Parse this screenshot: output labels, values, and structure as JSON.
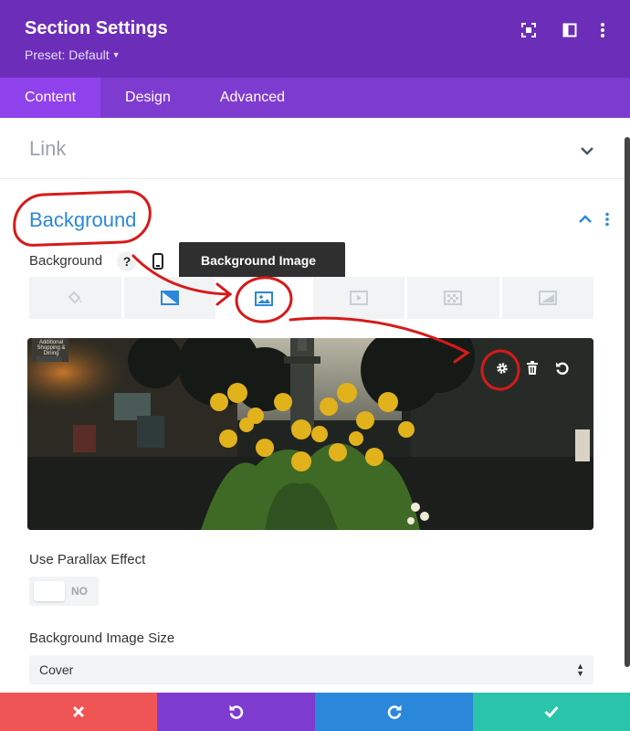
{
  "header": {
    "title": "Section Settings",
    "preset": "Preset: Default",
    "icons": [
      "expand-icon",
      "sidebar-icon",
      "more-vertical-icon"
    ],
    "background_color": "#6c2eb9"
  },
  "tabs": [
    {
      "label": "Content",
      "active": true
    },
    {
      "label": "Design",
      "active": false
    },
    {
      "label": "Advanced",
      "active": false
    }
  ],
  "sections": {
    "link": {
      "title": "Link",
      "expanded": false
    },
    "background": {
      "title": "Background",
      "expanded": true,
      "field_label": "Background",
      "help_symbol": "?",
      "tooltip": "Background Image",
      "type_tabs": [
        {
          "icon": "paint-bucket-icon",
          "active": false
        },
        {
          "icon": "gradient-icon",
          "active": false
        },
        {
          "icon": "image-icon",
          "active": true
        },
        {
          "icon": "video-icon",
          "active": false
        },
        {
          "icon": "pattern-icon",
          "active": false
        },
        {
          "icon": "mask-icon",
          "active": false
        }
      ],
      "preview": {
        "sign_text": "Additional Shopping & Dining",
        "actions": [
          "settings-icon",
          "trash-icon",
          "reset-icon"
        ]
      }
    }
  },
  "fields": {
    "parallax": {
      "label": "Use Parallax Effect",
      "value": "NO"
    },
    "image_size": {
      "label": "Background Image Size",
      "value": "Cover"
    }
  },
  "footer": [
    {
      "action": "cancel",
      "icon": "close-icon",
      "color": "#ef5555"
    },
    {
      "action": "undo",
      "icon": "undo-icon",
      "color": "#7d3bcf"
    },
    {
      "action": "redo",
      "icon": "redo-icon",
      "color": "#2b87da"
    },
    {
      "action": "save",
      "icon": "check-icon",
      "color": "#29c4a9"
    }
  ],
  "colors": {
    "accent_blue": "#2b87da",
    "tab_active": "#8f42ec",
    "annotation_red": "#d61a1a"
  }
}
